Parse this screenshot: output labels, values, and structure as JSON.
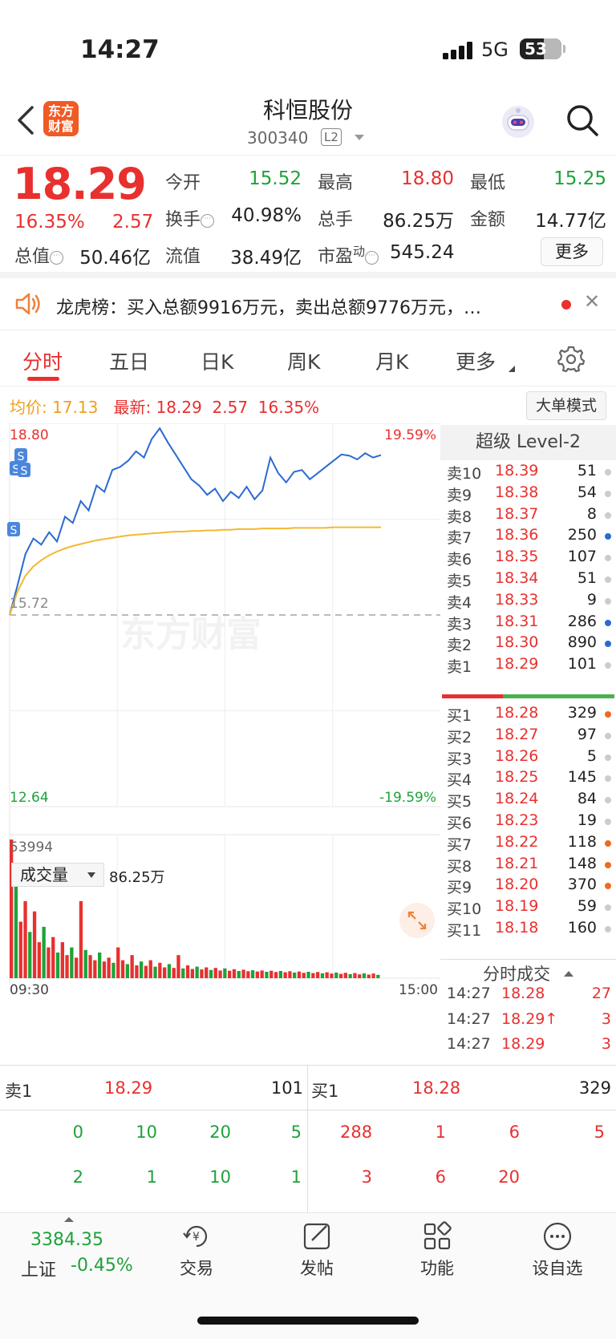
{
  "status_bar": {
    "time": "14:27",
    "network": "5G",
    "battery": "53"
  },
  "nav": {
    "logo_line1": "东方",
    "logo_line2": "财富",
    "stock_name": "科恒股份",
    "stock_code": "300340",
    "level_badge": "L2"
  },
  "quote": {
    "price": "18.29",
    "change_pct": "16.35%",
    "change": "2.57",
    "open_label": "今开",
    "open": "15.52",
    "high_label": "最高",
    "high": "18.80",
    "low_label": "最低",
    "low": "15.25",
    "turnover_label": "换手",
    "turnover": "40.98%",
    "volume_label": "总手",
    "volume": "86.25万",
    "amount_label": "金额",
    "amount": "14.77亿",
    "mcap_label": "总值",
    "mcap": "50.46亿",
    "float_label": "流值",
    "float": "38.49亿",
    "pe_label": "市盈",
    "pe_sup": "动",
    "pe": "545.24",
    "more_button": "更多"
  },
  "notice": {
    "text": "龙虎榜：买入总额9916万元，卖出总额9776万元，…"
  },
  "tabs": [
    "分时",
    "五日",
    "日K",
    "周K",
    "月K",
    "更多"
  ],
  "chart_info": {
    "avg_label": "均价:",
    "avg": "17.13",
    "latest_label": "最新:",
    "latest": "18.29",
    "latest_chg": "2.57",
    "latest_pct": "16.35%",
    "big_order_button": "大单模式"
  },
  "chart_data": [
    {
      "type": "line",
      "x_range": [
        "09:30",
        "15:00"
      ],
      "ylim": [
        12.64,
        18.8
      ],
      "reference": "15.72",
      "y_tick_labels": [
        "18.80",
        "15.72",
        "12.64"
      ],
      "right_tick_labels": [
        "19.59%",
        "-19.59%"
      ],
      "watermark": "东方财富",
      "series": [
        {
          "name": "最新",
          "color": "#2a6bd0",
          "values": [
            15.72,
            16.2,
            16.7,
            16.95,
            16.85,
            17.05,
            16.9,
            17.3,
            17.2,
            17.55,
            17.4,
            17.8,
            17.7,
            18.05,
            18.1,
            18.2,
            18.35,
            18.25,
            18.55,
            18.72,
            18.5,
            18.3,
            18.1,
            17.9,
            17.8,
            17.65,
            17.75,
            17.55,
            17.7,
            17.6,
            17.78,
            17.58,
            17.72,
            18.25,
            18.0,
            17.85,
            18.02,
            18.05,
            17.9,
            18.0,
            18.1,
            18.2,
            18.3,
            18.28,
            18.22,
            18.32,
            18.25,
            18.29
          ]
        },
        {
          "name": "均价",
          "color": "#f5b731",
          "values": [
            15.72,
            16.1,
            16.35,
            16.5,
            16.6,
            16.68,
            16.74,
            16.79,
            16.83,
            16.86,
            16.89,
            16.92,
            16.94,
            16.96,
            16.98,
            17.0,
            17.01,
            17.02,
            17.03,
            17.04,
            17.05,
            17.06,
            17.06,
            17.07,
            17.07,
            17.08,
            17.08,
            17.09,
            17.09,
            17.1,
            17.1,
            17.1,
            17.11,
            17.11,
            17.11,
            17.11,
            17.12,
            17.12,
            17.12,
            17.12,
            17.12,
            17.13,
            17.13,
            17.13,
            17.13,
            17.13,
            17.13,
            17.13
          ]
        }
      ]
    },
    {
      "type": "bar",
      "title": "成交量",
      "total": "86.25万",
      "max_label": "53994",
      "x_tick_labels": [
        "09:30",
        "15:00"
      ],
      "values": [
        53994,
        41000,
        22000,
        30000,
        18000,
        26000,
        14000,
        20000,
        12000,
        16000,
        10000,
        14000,
        9000,
        12000,
        8000,
        30000,
        11000,
        9000,
        7000,
        10000,
        6500,
        8000,
        6000,
        12000,
        7000,
        5500,
        9000,
        5000,
        6500,
        4800,
        7000,
        4500,
        6000,
        4200,
        5500,
        4000,
        9000,
        3800,
        5000,
        3600,
        4500,
        3400,
        4200,
        3200,
        4000,
        3000,
        3800,
        2900,
        3500,
        2800,
        3300,
        2700,
        3100,
        2600,
        3000,
        2500,
        2900,
        2400,
        2800,
        2300,
        2700,
        2200,
        2600,
        2100,
        2500,
        2000,
        2400,
        1900,
        2300,
        1800,
        2200,
        1700,
        2100,
        1600,
        2000,
        1500,
        1900,
        1400,
        1800,
        1300
      ],
      "colors": [
        "#e8302f",
        "#1ea23a"
      ]
    }
  ],
  "orderbook": {
    "title": "超级 Level-2",
    "asks": [
      {
        "label": "卖10",
        "price": "18.39",
        "vol": "51",
        "dot": "gray"
      },
      {
        "label": "卖9",
        "price": "18.38",
        "vol": "54",
        "dot": "gray"
      },
      {
        "label": "卖8",
        "price": "18.37",
        "vol": "8",
        "dot": "gray"
      },
      {
        "label": "卖7",
        "price": "18.36",
        "vol": "250",
        "dot": "blue"
      },
      {
        "label": "卖6",
        "price": "18.35",
        "vol": "107",
        "dot": "gray"
      },
      {
        "label": "卖5",
        "price": "18.34",
        "vol": "51",
        "dot": "gray"
      },
      {
        "label": "卖4",
        "price": "18.33",
        "vol": "9",
        "dot": "gray"
      },
      {
        "label": "卖3",
        "price": "18.31",
        "vol": "286",
        "dot": "blue"
      },
      {
        "label": "卖2",
        "price": "18.30",
        "vol": "890",
        "dot": "blue"
      },
      {
        "label": "卖1",
        "price": "18.29",
        "vol": "101",
        "dot": "gray"
      }
    ],
    "bids": [
      {
        "label": "买1",
        "price": "18.28",
        "vol": "329",
        "dot": "orange"
      },
      {
        "label": "买2",
        "price": "18.27",
        "vol": "97",
        "dot": "gray"
      },
      {
        "label": "买3",
        "price": "18.26",
        "vol": "5",
        "dot": "gray"
      },
      {
        "label": "买4",
        "price": "18.25",
        "vol": "145",
        "dot": "gray"
      },
      {
        "label": "买5",
        "price": "18.24",
        "vol": "84",
        "dot": "gray"
      },
      {
        "label": "买6",
        "price": "18.23",
        "vol": "19",
        "dot": "gray"
      },
      {
        "label": "买7",
        "price": "18.22",
        "vol": "118",
        "dot": "orange"
      },
      {
        "label": "买8",
        "price": "18.21",
        "vol": "148",
        "dot": "orange"
      },
      {
        "label": "买9",
        "price": "18.20",
        "vol": "370",
        "dot": "orange"
      },
      {
        "label": "买10",
        "price": "18.19",
        "vol": "59",
        "dot": "gray"
      },
      {
        "label": "买11",
        "price": "18.18",
        "vol": "160",
        "dot": "gray"
      }
    ],
    "trades_title": "分时成交",
    "trades": [
      {
        "time": "14:27",
        "price": "18.28",
        "vol": "27"
      },
      {
        "time": "14:27",
        "price": "18.29↑",
        "vol": "3"
      },
      {
        "time": "14:27",
        "price": "18.29",
        "vol": "3"
      }
    ]
  },
  "queue": {
    "sell_label": "卖1",
    "sell_price": "18.29",
    "sell_total": "101",
    "buy_label": "买1",
    "buy_price": "18.28",
    "buy_total": "329",
    "sell_row1": [
      "0",
      "10",
      "20",
      "5"
    ],
    "sell_row2": [
      "2",
      "1",
      "10",
      "1"
    ],
    "buy_row1": [
      "288",
      "1",
      "6",
      "5"
    ],
    "buy_row2": [
      "3",
      "6",
      "20"
    ]
  },
  "tabbar": {
    "index_value": "3384.35",
    "index_name": "上证",
    "index_pct": "-0.45%",
    "items": [
      "交易",
      "发帖",
      "功能",
      "设自选"
    ]
  }
}
